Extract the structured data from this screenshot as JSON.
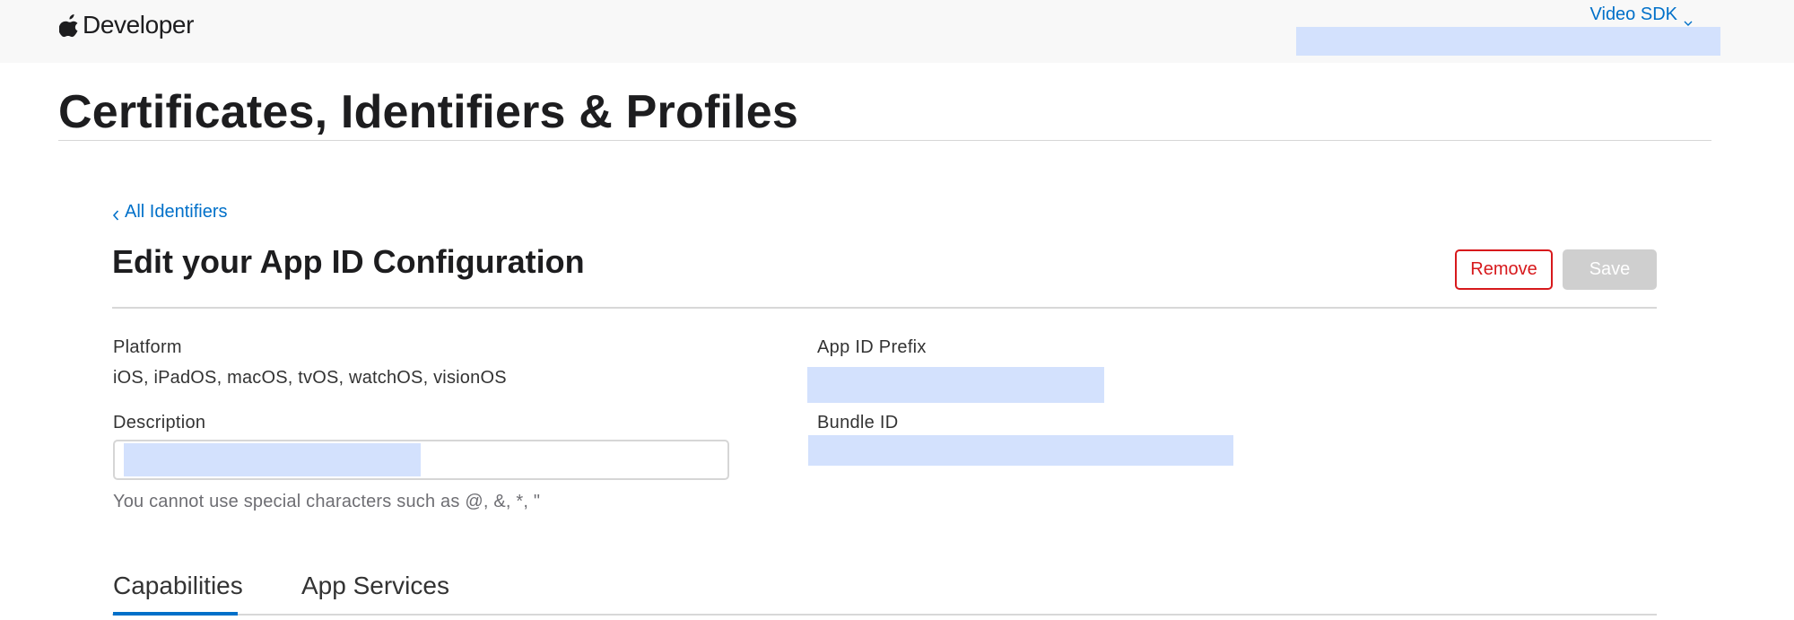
{
  "header": {
    "brand_name": "Developer",
    "account_name": "Video SDK",
    "logo_icon": "apple-logo-icon",
    "menu_icon": "chevron-down-icon"
  },
  "page": {
    "title": "Certificates, Identifiers & Profiles"
  },
  "breadcrumb": {
    "back_label": "All Identifiers",
    "back_icon": "chevron-left-icon"
  },
  "section": {
    "title": "Edit your App ID Configuration",
    "remove_label": "Remove",
    "save_label": "Save"
  },
  "fields": {
    "platform_label": "Platform",
    "platform_value": "iOS, iPadOS, macOS, tvOS, watchOS, visionOS",
    "description_label": "Description",
    "description_hint": "You cannot use special characters such as @, &, *, \"",
    "prefix_label": "App ID Prefix",
    "bundle_label": "Bundle ID"
  },
  "tabs": [
    {
      "label": "Capabilities",
      "active": true
    },
    {
      "label": "App Services",
      "active": false
    }
  ],
  "colors": {
    "link": "#0070c9",
    "danger": "#d7191c",
    "disabled": "#cfcfcf",
    "redaction": "#d3e1fd",
    "header_bg": "#f8f8f8"
  }
}
